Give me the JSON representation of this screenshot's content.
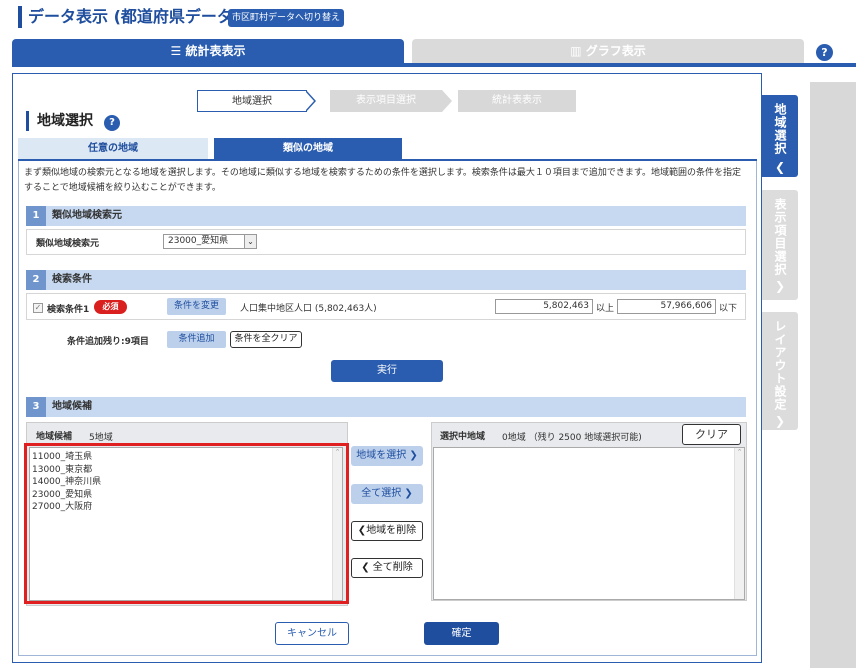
{
  "header": {
    "title": "データ表示 (都道府県データ)",
    "switch_label": "市区町村データへ切り替え"
  },
  "main_tabs": [
    {
      "label": "統計表表示"
    },
    {
      "label": "グラフ表示"
    }
  ],
  "help_symbol": "?",
  "steps": [
    {
      "label": "地域選択"
    },
    {
      "label": "表示項目選択"
    },
    {
      "label": "統計表表示"
    }
  ],
  "region_heading": "地域選択",
  "sub_tabs": [
    {
      "label": "任意の地域"
    },
    {
      "label": "類似の地域"
    }
  ],
  "description": "まず類似地域の検索元となる地域を選択します。その地域に類似する地域を検索するための条件を選択します。検索条件は最大１０項目まで追加できます。地域範囲の条件を指定することで地域候補を絞り込むことができます。",
  "section1": {
    "num": "1",
    "title": "類似地域検索元",
    "field_label": "類似地域検索元",
    "selected_value": "23000_愛知県"
  },
  "section2": {
    "num": "2",
    "title": "検索条件",
    "condition_label": "検索条件1",
    "required_badge": "必須",
    "change_button": "条件を変更",
    "condition_text": "人口集中地区人口 (5,802,463人)",
    "min_value": "5,802,463",
    "min_suffix": "以上",
    "max_value": "57,966,606",
    "max_suffix": "以下",
    "remaining_label": "条件追加残り:9項目",
    "add_button": "条件追加",
    "clear_all_button": "条件を全クリア",
    "execute_button": "実行"
  },
  "section3": {
    "num": "3",
    "title": "地域候補",
    "candidates_label": "地域候補",
    "candidates_count": "5地域",
    "candidates": [
      "11000_埼玉県",
      "13000_東京都",
      "14000_神奈川県",
      "23000_愛知県",
      "27000_大阪府"
    ],
    "select_button": "地域を選択",
    "select_all_button": "全て選択",
    "remove_button": "地域を削除",
    "remove_all_button": "全て削除",
    "selected_label": "選択中地域",
    "selected_info": "0地域 （残り 2500 地域選択可能)",
    "clear_button": "クリア"
  },
  "footer": {
    "cancel_button": "キャンセル",
    "confirm_button": "確定"
  },
  "side_tabs": [
    {
      "label": "地域選択"
    },
    {
      "label": "表示項目選択"
    },
    {
      "label": "レイアウト設定"
    }
  ],
  "colors": {
    "primary": "#2a5db0",
    "required": "#d9201f",
    "highlight_frame": "#e02020"
  }
}
